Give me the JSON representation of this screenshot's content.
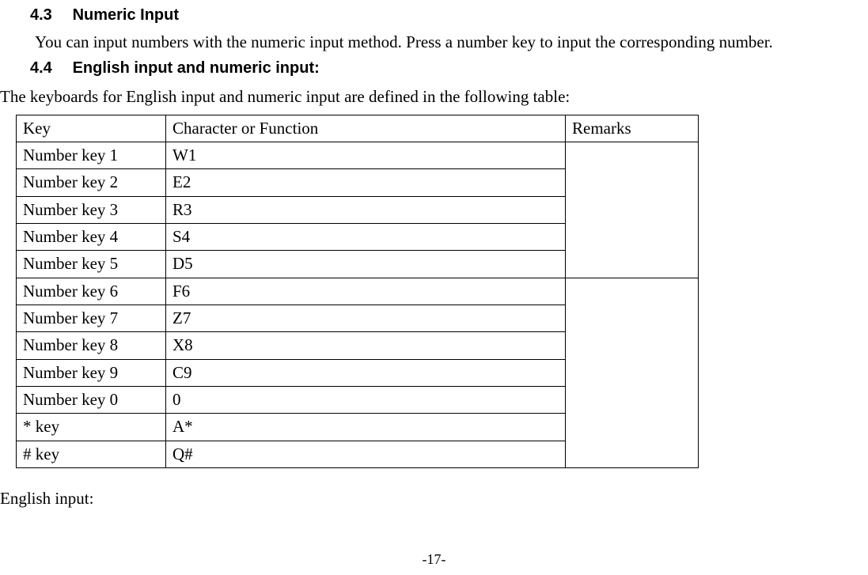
{
  "section43": {
    "number": "4.3",
    "title": "Numeric Input",
    "body": "You can input numbers with the numeric input method. Press a number key to input the corresponding number."
  },
  "section44": {
    "number": "4.4",
    "title": "English input and numeric input:",
    "intro": "The keyboards for English input and numeric input are defined in the following table:",
    "table": {
      "headers": {
        "col1": "Key",
        "col2": "Character or Function",
        "col3": "Remarks"
      },
      "rows": [
        {
          "key": "Number key 1",
          "char": "W1"
        },
        {
          "key": "Number key 2",
          "char": "E2"
        },
        {
          "key": "Number key 3",
          "char": "R3"
        },
        {
          "key": "Number key 4",
          "char": "S4"
        },
        {
          "key": "Number key 5",
          "char": "D5"
        },
        {
          "key": "Number key 6",
          "char": "F6"
        },
        {
          "key": "Number key 7",
          "char": "Z7"
        },
        {
          "key": "Number key 8",
          "char": "X8"
        },
        {
          "key": "Number key 9",
          "char": "C9"
        },
        {
          "key": "Number key 0",
          "char": "0"
        },
        {
          "key": "* key",
          "char": "A*"
        },
        {
          "key": "# key",
          "char": "Q#"
        }
      ],
      "remarks": [
        "",
        ""
      ]
    },
    "outro": "English input:"
  },
  "footer": {
    "pageno": "-17-"
  }
}
